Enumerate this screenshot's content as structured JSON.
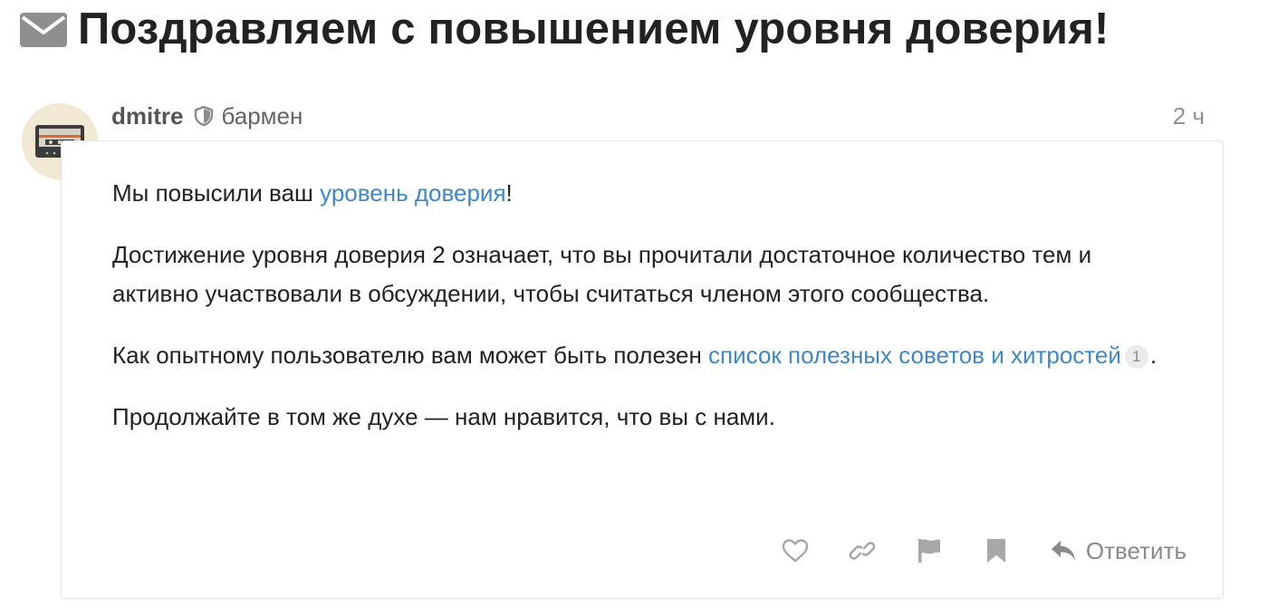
{
  "topic": {
    "title": "Поздравляем с повышением уровня доверия!",
    "icon": "envelope-icon"
  },
  "post": {
    "author": {
      "username": "dmitre",
      "badge_icon": "shield-icon",
      "user_title": "бармен",
      "avatar_icon": "cassette-tape-avatar"
    },
    "date": "2 ч",
    "paragraph1": {
      "before": "Мы повысили ваш ",
      "link_text": "уровень доверия",
      "after": "!"
    },
    "paragraph2": "Достижение уровня доверия 2 означает, что вы прочитали достаточное количество тем и активно участвовали в обсуждении, чтобы считаться членом этого сообщества.",
    "paragraph3": {
      "before": "Как опытному пользователю вам может быть полезен ",
      "link_text": "список полезных советов и хитростей",
      "click_count": "1",
      "after": "."
    },
    "paragraph4": "Продолжайте в том же духе — нам нравится, что вы с нами."
  },
  "actions": {
    "like_icon": "heart-icon",
    "share_icon": "link-icon",
    "flag_icon": "flag-icon",
    "bookmark_icon": "bookmark-icon",
    "reply_icon": "reply-icon",
    "reply_label": "Ответить"
  },
  "colors": {
    "link": "#3f88c5",
    "text": "#222222",
    "muted": "#a8a8a8",
    "avatar_bg": "#f2e9d4"
  }
}
